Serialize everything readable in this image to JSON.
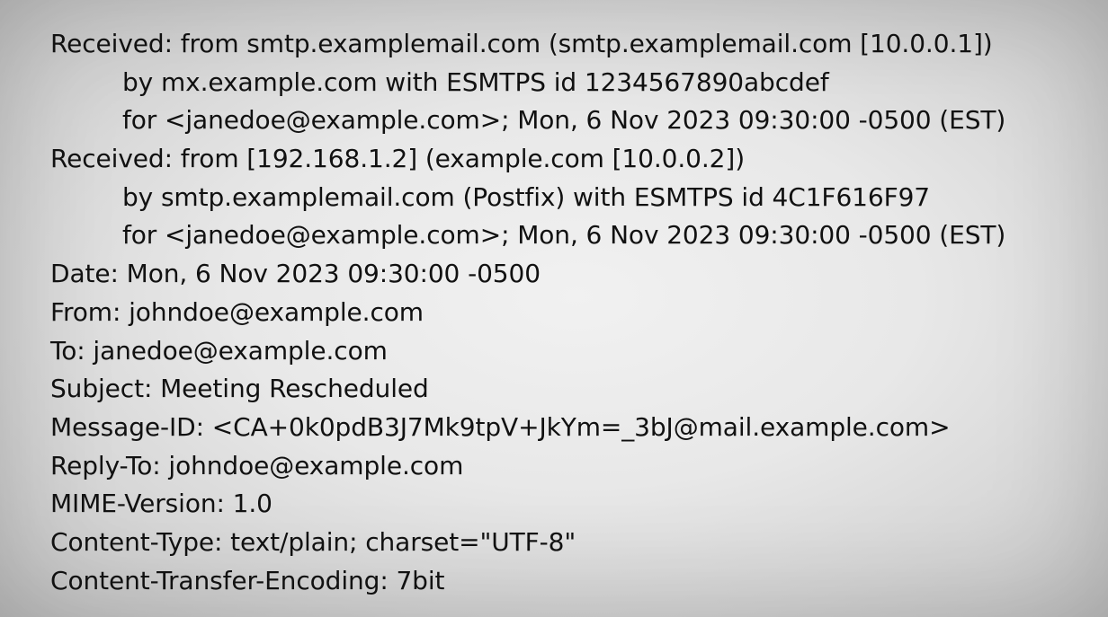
{
  "email_headers": {
    "received_1": {
      "line1": "Received: from smtp.examplemail.com (smtp.examplemail.com [10.0.0.1])",
      "line2": "by mx.example.com with ESMTPS id 1234567890abcdef",
      "line3": "for <janedoe@example.com>; Mon, 6 Nov 2023 09:30:00 -0500 (EST)"
    },
    "received_2": {
      "line1": "Received: from [192.168.1.2] (example.com [10.0.0.2])",
      "line2": "by smtp.examplemail.com (Postfix) with ESMTPS id 4C1F616F97",
      "line3": "for <janedoe@example.com>; Mon, 6 Nov 2023 09:30:00 -0500 (EST)"
    },
    "date": "Date: Mon, 6 Nov 2023 09:30:00 -0500",
    "from": "From: johndoe@example.com",
    "to": "To: janedoe@example.com",
    "subject": "Subject: Meeting Rescheduled",
    "message_id": "Message-ID: <CA+0k0pdB3J7Mk9tpV+JkYm=_3bJ@mail.example.com>",
    "reply_to": "Reply-To: johndoe@example.com",
    "mime_version": "MIME-Version: 1.0",
    "content_type": "Content-Type: text/plain; charset=\"UTF-8\"",
    "content_transfer_encoding": "Content-Transfer-Encoding: 7bit"
  }
}
